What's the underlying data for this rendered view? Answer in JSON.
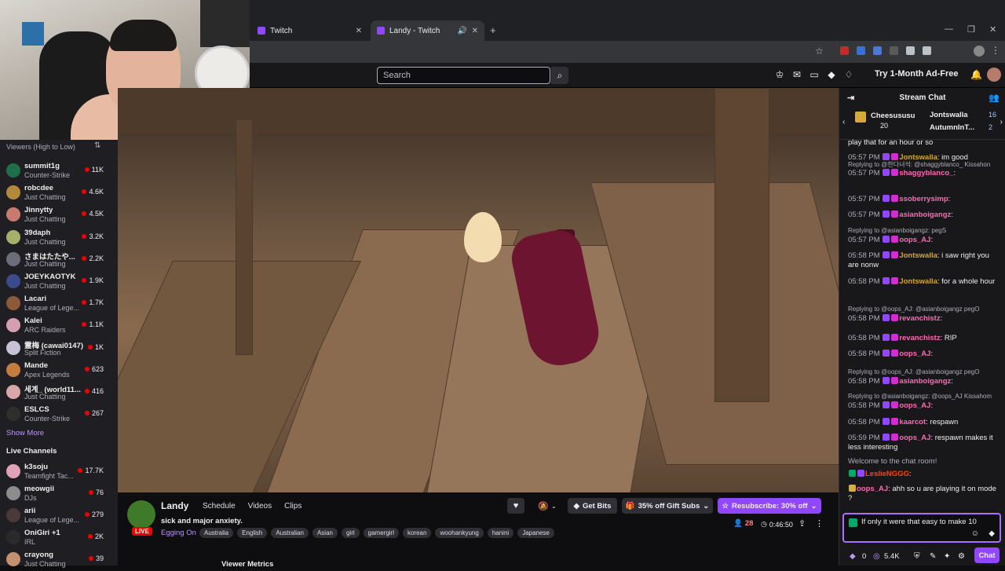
{
  "browser": {
    "tabs": [
      {
        "label": "Twitch",
        "active": false
      },
      {
        "label": "Landy - Twitch",
        "active": true
      }
    ]
  },
  "topnav": {
    "search_placeholder": "Search",
    "ad_free": "Try 1-Month Ad-Free"
  },
  "sidebar": {
    "sort_label": "Viewers (High to Low)",
    "followed": [
      {
        "name": "summit1g",
        "game": "Counter-Strike",
        "viewers": "11K",
        "color": "#1f6f4a"
      },
      {
        "name": "robcdee",
        "game": "Just Chatting",
        "viewers": "4.6K",
        "color": "#b08a3a"
      },
      {
        "name": "Jinnytty",
        "game": "Just Chatting",
        "viewers": "4.5K",
        "color": "#c77b6e"
      },
      {
        "name": "39daph",
        "game": "Just Chatting",
        "viewers": "3.2K",
        "color": "#a7b06a"
      },
      {
        "name": "さまはたたや...",
        "game": "Just Chatting",
        "viewers": "2.2K",
        "color": "#6b6e7a"
      },
      {
        "name": "JOEYKAOTYK",
        "game": "Just Chatting",
        "viewers": "1.9K",
        "color": "#3a4a8a"
      },
      {
        "name": "Lacari",
        "game": "League of Lege...",
        "viewers": "1.7K",
        "color": "#8a5a3a"
      },
      {
        "name": "Kalei",
        "game": "ARC Raiders",
        "viewers": "1.1K",
        "color": "#d49fb0"
      },
      {
        "name": "霊梅 (cawai0147)",
        "game": "Split Fiction",
        "viewers": "1K",
        "color": "#c9c2d6"
      },
      {
        "name": "Mande",
        "game": "Apex Legends",
        "viewers": "623",
        "color": "#c27d3d"
      },
      {
        "name": "세계_ (world11...",
        "game": "Just Chatting",
        "viewers": "416",
        "color": "#d8a7a7"
      },
      {
        "name": "ESLCS",
        "game": "Counter-Strike",
        "viewers": "267",
        "color": "#2e2e2e"
      }
    ],
    "show_more": "Show More",
    "live_header": "Live Channels",
    "live": [
      {
        "name": "k3soju",
        "game": "Teamfight Tac...",
        "viewers": "17.7K",
        "color": "#e1a2b5"
      },
      {
        "name": "meowgii",
        "game": "DJs",
        "viewers": "76",
        "color": "#8c8c8c"
      },
      {
        "name": "arii",
        "game": "League of Lege...",
        "viewers": "279",
        "color": "#4a3a3a"
      },
      {
        "name": "OniGiri +1",
        "game": "IRL",
        "viewers": "2K",
        "color": "#2a2a2a"
      },
      {
        "name": "crayong",
        "game": "Just Chatting",
        "viewers": "39",
        "color": "#c49070"
      }
    ]
  },
  "stream": {
    "name": "Landy",
    "links": [
      "Schedule",
      "Videos",
      "Clips"
    ],
    "title": "sick and major anxiety.",
    "game": "Egging On",
    "live_label": "LIVE",
    "tags": [
      "Australia",
      "English",
      "Australian",
      "Asian",
      "girl",
      "gamergirl",
      "korean",
      "woohankyung",
      "hanini",
      "Japanese"
    ],
    "get_bits": "Get Bits",
    "gift_subs": "35% off Gift Subs",
    "resubscribe": "Resubscribe: 30% off",
    "viewers": "28",
    "uptime": "0:46:50",
    "metrics_label": "Viewer Metrics"
  },
  "chat": {
    "header": "Stream Chat",
    "pinned": [
      {
        "name": "Cheesususu",
        "count": "20"
      },
      {
        "name": "Jontswalla",
        "count": "16"
      },
      {
        "name": "AutumnInT...",
        "count": "2"
      }
    ],
    "partial_top": "play that for an hour or so",
    "messages": [
      {
        "reply": "",
        "ts": "05:57 PM",
        "user": "Jontswalla",
        "color": "#daa520",
        "text": ": im good"
      },
      {
        "reply": "Replying to @한다녀석: @shaggyblanco_ Kissahon",
        "ts": "05:57 PM",
        "user": "shaggyblanco_",
        "color": "#ff69b4",
        "text": ":"
      },
      {
        "reply": "",
        "ts": "05:57 PM",
        "user": "ssoberrysimp",
        "color": "#ff69b4",
        "text": ":"
      },
      {
        "reply": "",
        "ts": "05:57 PM",
        "user": "asianboigangz",
        "color": "#ff69b4",
        "text": ":"
      },
      {
        "reply": "Replying to @asianboigangz: pegS",
        "ts": "05:57 PM",
        "user": "oops_AJ",
        "color": "#ff69b4",
        "text": ":"
      },
      {
        "reply": "",
        "ts": "05:58 PM",
        "user": "Jontswalla",
        "color": "#daa520",
        "text": ": i saw right you are nonw"
      },
      {
        "reply": "",
        "ts": "05:58 PM",
        "user": "Jontswalla",
        "color": "#daa520",
        "text": ": for a whole hour"
      },
      {
        "reply": "Replying to @oops_AJ: @asianboigangz pegO",
        "ts": "05:58 PM",
        "user": "revanchistz",
        "color": "#ff69b4",
        "text": ":"
      },
      {
        "reply": "",
        "ts": "05:58 PM",
        "user": "revanchistz",
        "color": "#ff69b4",
        "text": ": RIP"
      },
      {
        "reply": "",
        "ts": "05:58 PM",
        "user": "oops_AJ",
        "color": "#ff69b4",
        "text": ":"
      },
      {
        "reply": "Replying to @oops_AJ: @asianboigangz pegO",
        "ts": "05:58 PM",
        "user": "asianboigangz",
        "color": "#ff69b4",
        "text": ":"
      },
      {
        "reply": "Replying to @asianboigangz: @oops_AJ Kissahom",
        "ts": "05:58 PM",
        "user": "oops_AJ",
        "color": "#ff69b4",
        "text": ":"
      },
      {
        "reply": "",
        "ts": "05:58 PM",
        "user": "kaarcot",
        "color": "#ff69b4",
        "text": ": respawn"
      },
      {
        "reply": "",
        "ts": "05:59 PM",
        "user": "oops_AJ",
        "color": "#ff69b4",
        "text": ": respawn makes it less interesting"
      }
    ],
    "welcome": "Welcome to the chat room!",
    "after": [
      {
        "user": "LeslieNGGG",
        "color": "#ff4500",
        "text": ":"
      },
      {
        "user": "oops_AJ",
        "color": "#ff69b4",
        "text": ": ahh so u are playing it on mode ?"
      }
    ],
    "input_text": "If only it were that easy to make 10",
    "bits": "0",
    "points": "5.4K",
    "chat_button": "Chat"
  }
}
